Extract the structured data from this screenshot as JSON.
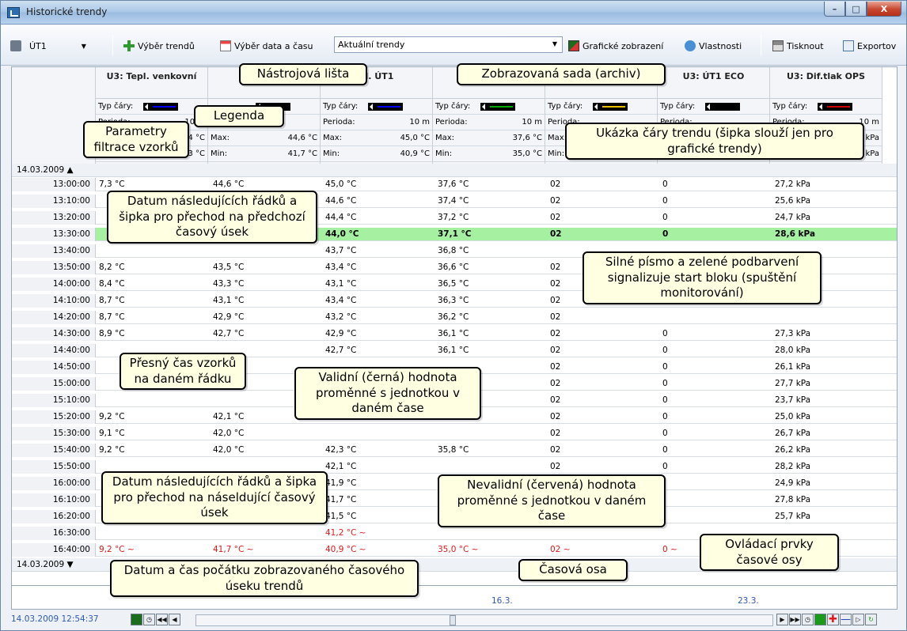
{
  "window": {
    "title": "Historické trendy",
    "buttons": [
      "–",
      "□",
      "X"
    ]
  },
  "toolbar": {
    "sada": "ÚT1",
    "vyber_trendu": "Výběr trendů",
    "vyber_data": "Výběr data a času",
    "combo_value": "Aktuální trendy",
    "graficke": "Grafické zobrazení",
    "vlastnosti": "Vlastnosti",
    "tisknout": "Tisknout",
    "exportovat": "Exportov"
  },
  "columns": [
    {
      "title": "U3: Tepl. venkovní",
      "typ": "Typ čáry:",
      "perioda": "10 m",
      "max": "4 °C",
      "min": "3 °C",
      "color": "#0000ff"
    },
    {
      "title": "U3",
      "typ": "",
      "perioda": "",
      "max": "44,6 °C",
      "min": "41,7 °C",
      "color": "#000000"
    },
    {
      "title": "pl. ÚT1",
      "typ": "Typ čáry:",
      "perioda": "10 m",
      "max": "45,0 °C",
      "min": "40,9 °C",
      "color": "#0000ff"
    },
    {
      "title": "U3",
      "typ": "Typ čáry:",
      "perioda": "10 m",
      "max": "37,6 °C",
      "min": "35,0 °C",
      "color": "#00aa00"
    },
    {
      "title": "",
      "typ": "Typ čáry:",
      "perioda": "",
      "max": "",
      "min": "",
      "color": "#e8c000"
    },
    {
      "title": "U3: ÚT1 ECO",
      "typ": "Typ čáry:",
      "perioda": "",
      "max": "",
      "min": "",
      "color": "#000000"
    },
    {
      "title": "U3: Dif.tlak OPS",
      "typ": "Typ čáry:",
      "perioda": "10 m",
      "max": "kPa",
      "min": "kPa",
      "color": "#cc0000"
    }
  ],
  "labels": {
    "typ": "Typ čáry:",
    "perioda": "Perioda:",
    "max": "Max:",
    "min": "Min:"
  },
  "date_top": "14.03.2009",
  "date_bottom": "14.03.2009",
  "rows": [
    {
      "t": "13:00:00",
      "v": [
        "7,3 °C",
        "44,6 °C",
        "45,0 °C",
        "37,6 °C",
        "02",
        "0",
        "27,2 kPa"
      ]
    },
    {
      "t": "13:10:00",
      "v": [
        "",
        "",
        "44,6 °C",
        "37,4 °C",
        "02",
        "0",
        "25,6 kPa"
      ]
    },
    {
      "t": "13:20:00",
      "v": [
        "",
        "",
        "44,4 °C",
        "37,2 °C",
        "02",
        "0",
        "24,7 kPa"
      ]
    },
    {
      "t": "13:30:00",
      "v": [
        "",
        "",
        "44,0 °C",
        "37,1 °C",
        "02",
        "0",
        "28,6 kPa"
      ],
      "hl": true
    },
    {
      "t": "13:40:00",
      "v": [
        "",
        "",
        "43,7 °C",
        "36,8 °C",
        "",
        "",
        ""
      ]
    },
    {
      "t": "13:50:00",
      "v": [
        "8,2 °C",
        "43,5 °C",
        "43,4 °C",
        "36,6 °C",
        "02",
        "",
        ""
      ]
    },
    {
      "t": "14:00:00",
      "v": [
        "8,4 °C",
        "43,3 °C",
        "43,1 °C",
        "36,5 °C",
        "02",
        "",
        ""
      ]
    },
    {
      "t": "14:10:00",
      "v": [
        "8,7 °C",
        "43,1 °C",
        "43,4 °C",
        "36,3 °C",
        "02",
        "",
        ""
      ]
    },
    {
      "t": "14:20:00",
      "v": [
        "8,7 °C",
        "42,9 °C",
        "43,2 °C",
        "36,2 °C",
        "02",
        "",
        ""
      ]
    },
    {
      "t": "14:30:00",
      "v": [
        "8,9 °C",
        "42,7 °C",
        "42,9 °C",
        "36,1 °C",
        "02",
        "0",
        "27,3 kPa"
      ]
    },
    {
      "t": "14:40:00",
      "v": [
        "",
        "",
        "42,7 °C",
        "36,1 °C",
        "02",
        "0",
        "28,0 kPa"
      ]
    },
    {
      "t": "14:50:00",
      "v": [
        "",
        "",
        "",
        "",
        "02",
        "0",
        "26,1 kPa"
      ]
    },
    {
      "t": "15:00:00",
      "v": [
        "",
        "",
        "",
        "",
        "02",
        "0",
        "27,7 kPa"
      ]
    },
    {
      "t": "15:10:00",
      "v": [
        "",
        "",
        "",
        "",
        "02",
        "0",
        "23,7 kPa"
      ]
    },
    {
      "t": "15:20:00",
      "v": [
        "9,2 °C",
        "42,1 °C",
        "",
        "",
        "02",
        "0",
        "25,0 kPa"
      ]
    },
    {
      "t": "15:30:00",
      "v": [
        "9,1 °C",
        "42,0 °C",
        "",
        "",
        "02",
        "0",
        "26,7 kPa"
      ]
    },
    {
      "t": "15:40:00",
      "v": [
        "9,2 °C",
        "42,0 °C",
        "42,3 °C",
        "35,8 °C",
        "02",
        "0",
        "26,2 kPa"
      ]
    },
    {
      "t": "15:50:00",
      "v": [
        "",
        "",
        "42,1 °C",
        "",
        "02",
        "0",
        "28,2 kPa"
      ]
    },
    {
      "t": "16:00:00",
      "v": [
        "",
        "",
        "41,9 °C",
        "",
        "",
        "",
        "24,9 kPa"
      ]
    },
    {
      "t": "16:10:00",
      "v": [
        "",
        "",
        "41,7 °C",
        "",
        "",
        "",
        "27,8 kPa"
      ]
    },
    {
      "t": "16:20:00",
      "v": [
        "",
        "",
        "41,5 °C",
        "",
        "",
        "",
        "25,7 kPa"
      ]
    },
    {
      "t": "16:30:00",
      "v": [
        "",
        "",
        "41,2 °C ~",
        "",
        "",
        "",
        ""
      ],
      "bad": true
    },
    {
      "t": "16:40:00",
      "v": [
        "9,2 °C ~",
        "41,7 °C ~",
        "40,9 °C ~",
        "35,0 °C ~",
        "02 ~",
        "0 ~",
        ""
      ],
      "bad": true
    }
  ],
  "timeaxis": {
    "tick1": "16.3.",
    "tick2": "23.3."
  },
  "status": {
    "start_time": "14.03.2009 12:54:37"
  },
  "callouts": {
    "nastrojova": "Nástrojová lišta",
    "sada": "Zobrazovaná sada (archiv)",
    "legenda": "Legenda",
    "parametry": "Parametry filtrace vzorků",
    "ukazka": "Ukázka čáry trendu (šipka slouží jen pro grafické trendy)",
    "datum1": "Datum následujících řádků a šipka pro přechod na předchozí časový úsek",
    "silne": "Silné písmo a zelené podbarvení signalizuje start bloku (spuštění monitorování)",
    "presny": "Přesný čas vzorků na daném řádku",
    "validni": "Validní (černá) hodnota proměnné s jednotkou v daném čase",
    "datum2": "Datum následujících řádků a šipka pro přechod na náseldující časový úsek",
    "nevalidni": "Nevalidní (červená) hodnota proměnné s jednotkou v daném čase",
    "ovladaci": "Ovládací prvky časové osy",
    "casova": "Časová osa",
    "pocatek": "Datum a čas počátku zobrazovaného časového úseku trendů"
  }
}
